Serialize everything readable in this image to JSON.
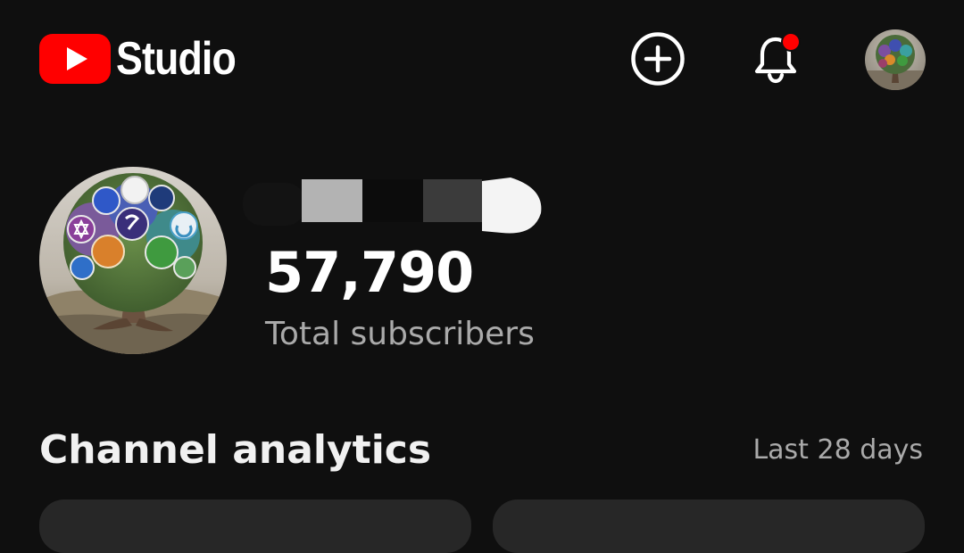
{
  "header": {
    "app_name": "Studio",
    "icons": {
      "logo": "youtube-play-icon",
      "create": "add-circle-icon",
      "notifications": "bell-icon",
      "account": "avatar"
    },
    "notification_dot_color": "#ff0000",
    "brand_color": "#ff0000"
  },
  "channel": {
    "subscriber_count": "57,790",
    "subscriber_label": "Total subscribers"
  },
  "analytics": {
    "title": "Channel analytics",
    "period": "Last 28 days"
  }
}
